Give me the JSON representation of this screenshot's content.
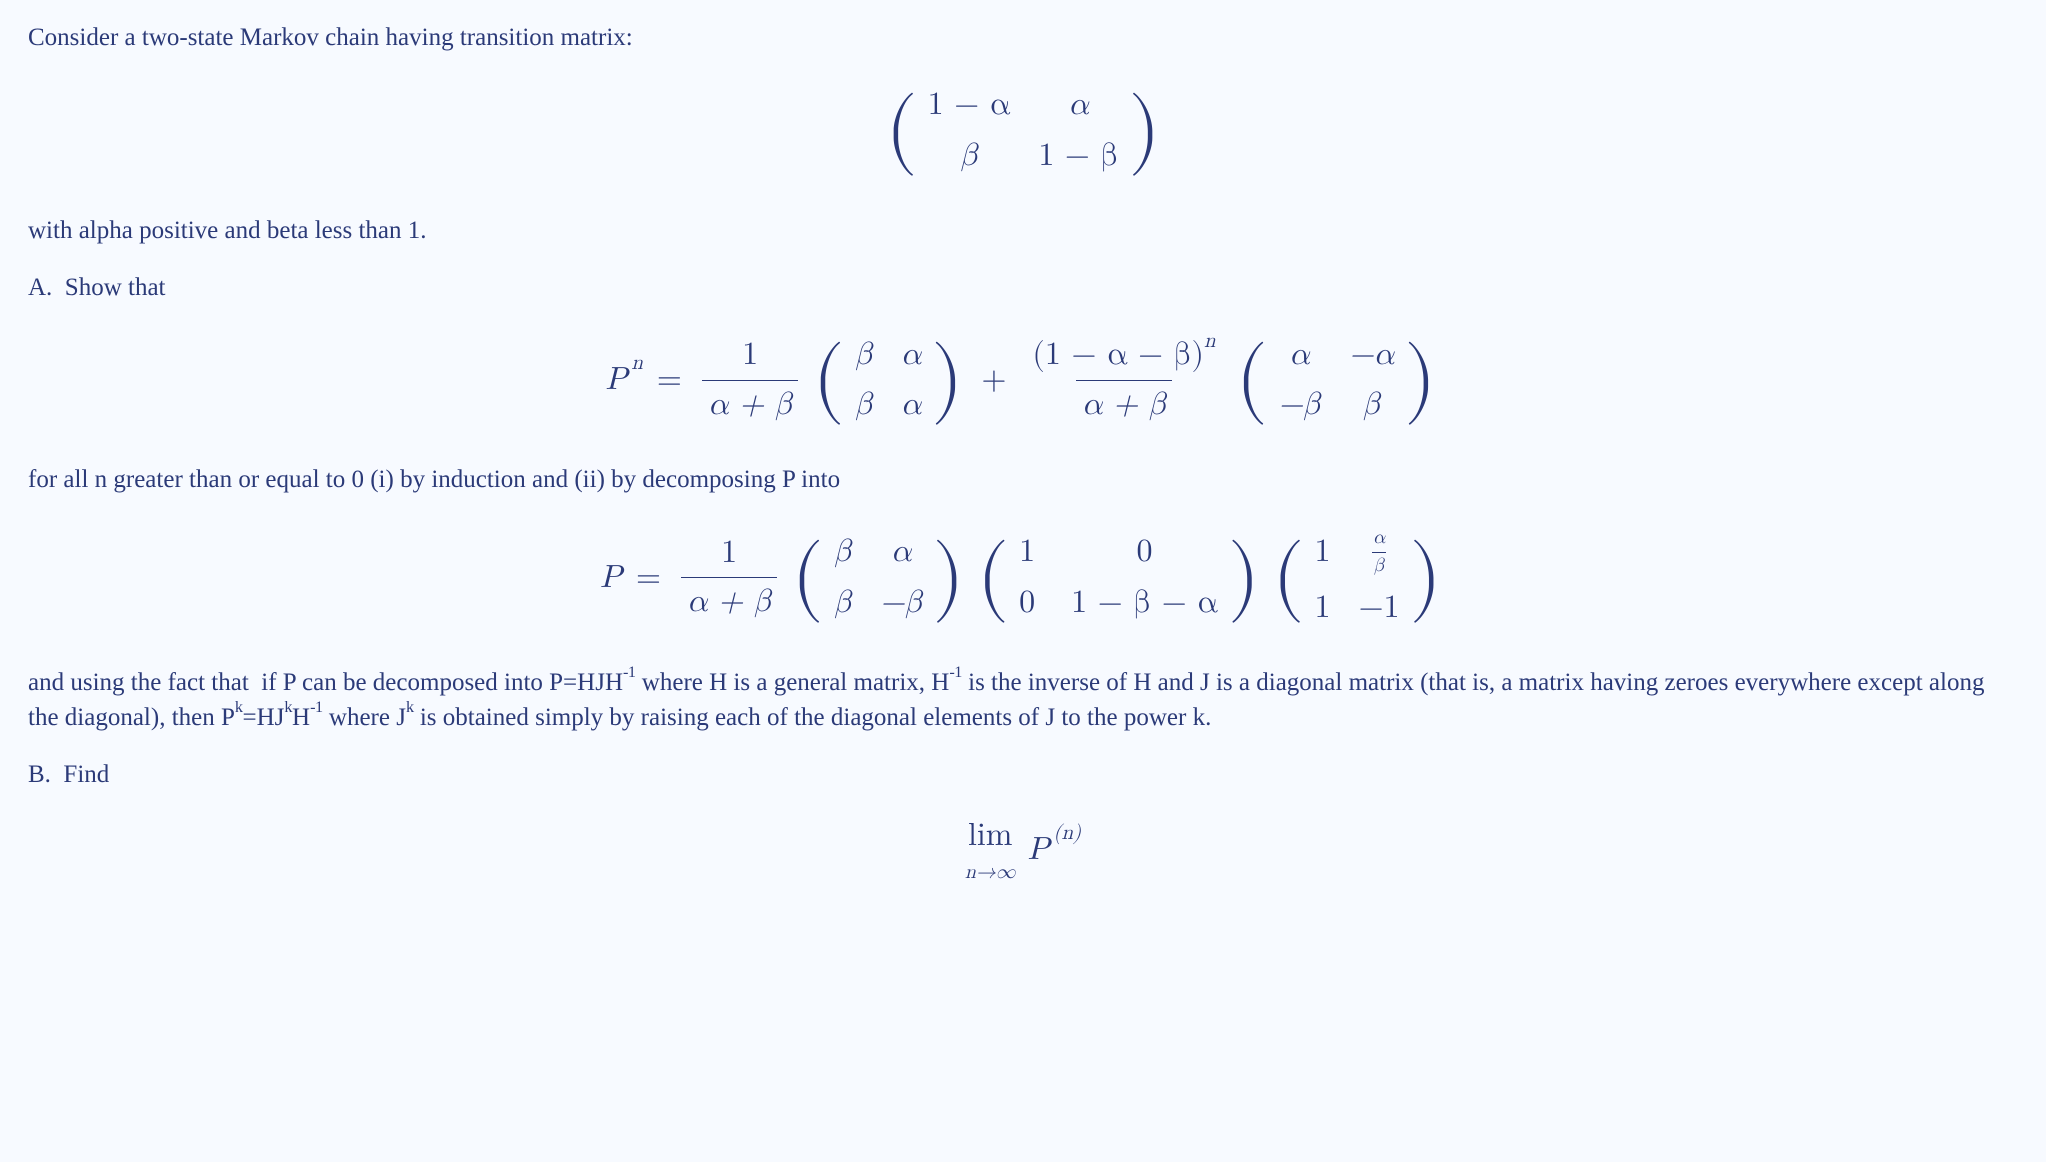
{
  "intro": "Consider a two-state Markov chain having transition matrix:",
  "eqP": {
    "r0c0": "1 − α",
    "r0c1": "α",
    "r1c0": "β",
    "r1c1": "1 − β"
  },
  "cond": "with alpha positive and beta less than 1.",
  "partA_label": "A. Show that",
  "eqPn": {
    "lhs_base": "P",
    "lhs_exp": "n",
    "eq": "=",
    "term1": {
      "num": "1",
      "den": "α + β",
      "mat": {
        "r0c0": "β",
        "r0c1": "α",
        "r1c0": "β",
        "r1c1": "α"
      }
    },
    "plus": "+",
    "term2": {
      "num_base": "(1 − α − β)",
      "num_exp": "n",
      "den": "α + β",
      "mat": {
        "r0c0": "α",
        "r0c1": "−α",
        "r1c0": "−β",
        "r1c1": "β"
      }
    }
  },
  "body2": "for all n greater than or equal to 0 (i) by induction and (ii) by decomposing P into",
  "eqDecomp": {
    "lhs": "P",
    "eq": "=",
    "coef_num": "1",
    "coef_den": "α + β",
    "m1": {
      "r0c0": "β",
      "r0c1": "α",
      "r1c0": "β",
      "r1c1": "−β"
    },
    "m2": {
      "r0c0": "1",
      "r0c1": "0",
      "r1c0": "0",
      "r1c1": "1 − β − α"
    },
    "m3": {
      "r0c0": "1",
      "r0c1_num": "α",
      "r0c1_den": "β",
      "r1c0": "1",
      "r1c1": "−1"
    }
  },
  "body3_a": "and using the fact that if P can be decomposed into P=HJH",
  "sup_m1_a": "-1",
  "body3_b": " where H is a general matrix, H",
  "sup_m1_b": "-1",
  "body3_c": " is the inverse of H and J is a diagonal matrix (that is, a matrix having zeroes everywhere except along the diagonal), then P",
  "sup_k_a": "k",
  "body3_d": "=HJ",
  "sup_k_b": "k",
  "body3_e": "H",
  "sup_m1_c": "-1",
  "body3_f": " where J",
  "sup_k_c": "k",
  "body3_g": " is obtained simply by raising each of the diagonal elements of J to the power k.",
  "partB_label": "B. Find",
  "eqLim": {
    "lim": "lim",
    "sub": "n→∞",
    "base": "P",
    "exp": "(n)"
  }
}
